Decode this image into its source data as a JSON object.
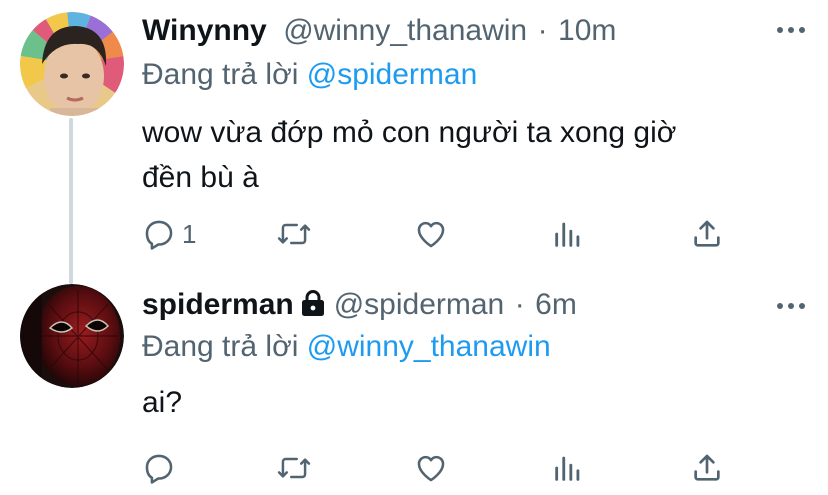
{
  "tweets": [
    {
      "name": "Winynny",
      "handle": "@winny_thanawin",
      "time": "10m",
      "reply_prefix": "Đang trả lời",
      "reply_mention": "@spiderman",
      "text_line1": "wow vừa đớp mỏ con người ta xong giờ",
      "text_line2": "đền bù à",
      "reply_count": "1",
      "icons": [
        "reply-icon",
        "retweet-icon",
        "like-icon",
        "analytics-icon",
        "share-icon",
        "more-icon"
      ]
    },
    {
      "name": "spiderman",
      "handle": "@spiderman",
      "time": "6m",
      "reply_prefix": "Đang trả lời",
      "reply_mention": "@winny_thanawin",
      "text_line1": "ai?",
      "icons": [
        "lock-icon",
        "reply-icon",
        "retweet-icon",
        "like-icon",
        "analytics-icon",
        "share-icon",
        "more-icon"
      ]
    }
  ],
  "dot": "·",
  "colors": {
    "text": "#0f1419",
    "secondary": "#536471",
    "link": "#1d9bf0",
    "line": "#cfd9de"
  }
}
